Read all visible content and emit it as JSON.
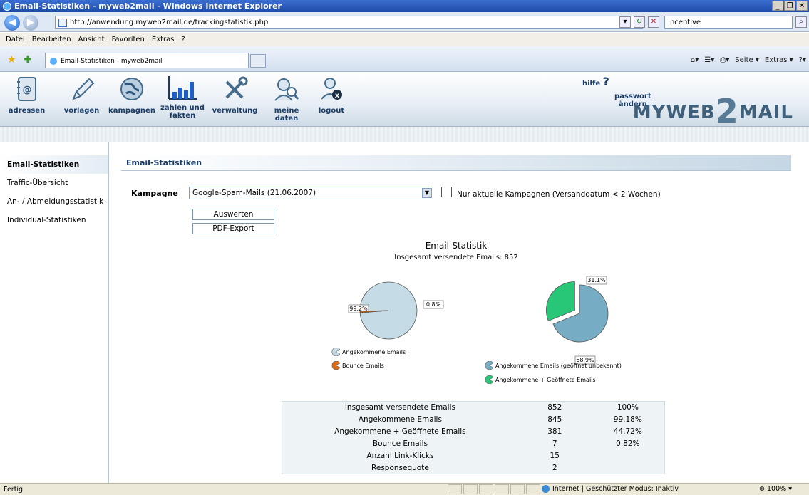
{
  "browser": {
    "title": "Email-Statistiken - myweb2mail - Windows Internet Explorer",
    "url": "http://anwendung.myweb2mail.de/trackingstatistik.php",
    "search_value": "Incentive",
    "menu": [
      "Datei",
      "Bearbeiten",
      "Ansicht",
      "Favoriten",
      "Extras",
      "?"
    ],
    "tab_title": "Email-Statistiken - myweb2mail",
    "cmd_page": "Seite",
    "cmd_extras": "Extras",
    "status_left": "Fertig",
    "status_zone": "Internet | Geschützter Modus: Inaktiv",
    "status_zoom": "100%"
  },
  "app": {
    "nav": [
      {
        "label": "adressen",
        "label2": ""
      },
      {
        "label": "vorlagen",
        "label2": ""
      },
      {
        "label": "kampagnen",
        "label2": ""
      },
      {
        "label": "zahlen und",
        "label2": "fakten"
      },
      {
        "label": "verwaltung",
        "label2": ""
      },
      {
        "label": "meine daten",
        "label2": ""
      },
      {
        "label": "logout",
        "label2": ""
      }
    ],
    "help": "hilfe",
    "password_line1": "passwort",
    "password_line2": "ändern",
    "brand_left": "MYWEB",
    "brand_two": "2",
    "brand_right": "MAIL"
  },
  "sidebar": {
    "items": [
      "Email-Statistiken",
      "Traffic-Übersicht",
      "An- / Abmeldungsstatistik",
      "Individual-Statistiken"
    ]
  },
  "page": {
    "section_title": "Email-Statistiken",
    "campaign_label": "Kampagne",
    "campaign_selected": "Google-Spam-Mails (21.06.2007)",
    "checkbox_label": "Nur aktuelle Kampagnen (Versanddatum < 2 Wochen)",
    "btn_evaluate": "Auswerten",
    "btn_pdf": "PDF-Export",
    "chart_title": "Email-Statistik",
    "chart_subtitle": "Insgesamt versendete Emails: 852"
  },
  "chart_data": [
    {
      "type": "pie",
      "title": "",
      "categories": [
        "Angekommene Emails",
        "Bounce Emails"
      ],
      "values": [
        99.2,
        0.8
      ],
      "labels": [
        "99.2%",
        "0.8%"
      ],
      "colors": [
        "#c5dce6",
        "#e06a10"
      ]
    },
    {
      "type": "pie",
      "title": "",
      "categories": [
        "Angekommene Emails (geöffnet unbekannt)",
        "Angekommene + Geöffnete Emails"
      ],
      "values": [
        68.9,
        31.1
      ],
      "labels": [
        "68.9%",
        "31.1%"
      ],
      "colors": [
        "#76acc4",
        "#27c777"
      ]
    }
  ],
  "stats_table": [
    [
      "Insgesamt versendete Emails",
      "852",
      "100%"
    ],
    [
      "Angekommene Emails",
      "845",
      "99.18%"
    ],
    [
      "Angekommene + Geöffnete Emails",
      "381",
      "44.72%"
    ],
    [
      "Bounce Emails",
      "7",
      "0.82%"
    ],
    [
      "Anzahl Link-Klicks",
      "15",
      ""
    ],
    [
      "Responsequote",
      "2",
      ""
    ]
  ]
}
